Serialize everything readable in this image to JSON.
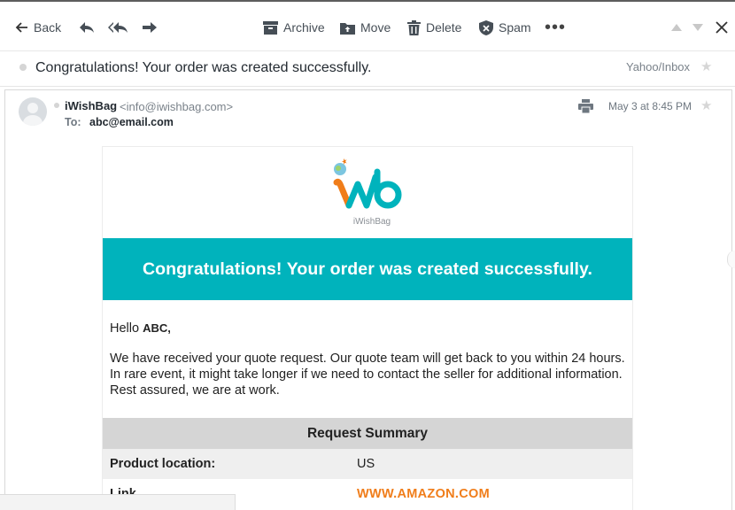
{
  "toolbar": {
    "back_label": "Back",
    "archive_label": "Archive",
    "move_label": "Move",
    "delete_label": "Delete",
    "spam_label": "Spam",
    "more_label": "•••"
  },
  "subject": {
    "text": "Congratulations! Your order was created successfully.",
    "folder": "Yahoo/Inbox"
  },
  "message": {
    "sender_name": "iWishBag",
    "sender_email": "<info@iwishbag.com>",
    "to_label": "To:",
    "to_value": "abc@email.com",
    "date": "May 3 at 8:45 PM"
  },
  "email": {
    "logo_text": "iWishBag",
    "banner_text": "Congratulations! Your order was created successfully.",
    "greeting_prefix": "Hello",
    "greeting_name": "ABC,",
    "paragraph": "We have received your quote request. Our quote team will get back to you within 24 hours. In rare event, it might take longer if we need to contact the seller for additional information. Rest assured, we are at work.",
    "summary_title": "Request Summary",
    "rows": [
      {
        "key": "Product location:",
        "value": "US"
      },
      {
        "key": "Link",
        "value": "WWW.AMAZON.COM"
      }
    ]
  },
  "colors": {
    "banner": "#00b3bc",
    "link": "#f07d1a",
    "summary_header": "#d5d5d5"
  }
}
